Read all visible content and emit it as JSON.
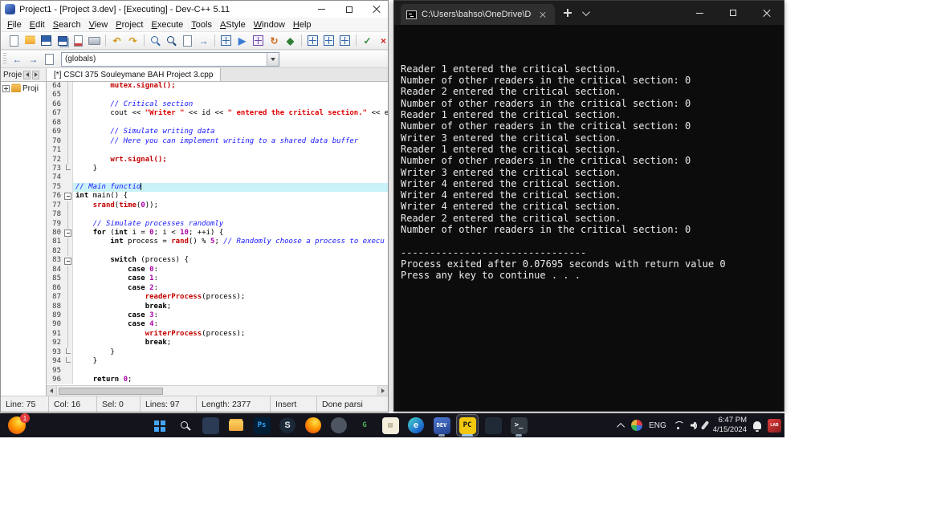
{
  "colors": {
    "keyword": "#000000",
    "comment": "#1616ff",
    "string": "#e00000",
    "number": "#aa00aa",
    "function": "#c40000",
    "line_highlight": "#c9f2f8",
    "console_bg": "#0c0c0c",
    "console_text": "#ececec",
    "taskbar_bg": "#14141d"
  },
  "devcpp": {
    "title": "Project1 - [Project 3.dev] - [Executing] - Dev-C++ 5.11",
    "menus": [
      "File",
      "Edit",
      "Search",
      "View",
      "Project",
      "Execute",
      "Tools",
      "AStyle",
      "Window",
      "Help"
    ],
    "toolbar_main": [
      {
        "name": "new-source-icon",
        "kind": "page"
      },
      {
        "name": "open-file-icon",
        "kind": "folder"
      },
      {
        "name": "save-icon",
        "kind": "save"
      },
      {
        "name": "save-all-icon",
        "kind": "saveall"
      },
      {
        "name": "close-file-icon",
        "kind": "pagex"
      },
      {
        "name": "print-icon",
        "kind": "print"
      },
      {
        "sep": true
      },
      {
        "name": "undo-icon",
        "glyph": "↶",
        "color": "#d29a22"
      },
      {
        "name": "redo-icon",
        "glyph": "↷",
        "color": "#d29a22"
      },
      {
        "sep": true
      },
      {
        "name": "find-icon",
        "kind": "find"
      },
      {
        "name": "find-in-files-icon",
        "kind": "find2"
      },
      {
        "name": "replace-icon",
        "kind": "page"
      },
      {
        "name": "goto-line-icon",
        "glyph": "→",
        "color": "#3465a4"
      },
      {
        "sep": true
      },
      {
        "name": "compile-icon",
        "kind": "grid"
      },
      {
        "name": "run-icon",
        "glyph": "▶",
        "color": "#3a7bd5"
      },
      {
        "name": "compile-run-icon",
        "kind": "gridrun"
      },
      {
        "name": "rebuild-icon",
        "glyph": "↻",
        "color": "#d2691e"
      },
      {
        "name": "debug-icon",
        "glyph": "◆",
        "color": "#2e7d32"
      },
      {
        "sep": true
      },
      {
        "name": "insert-icon",
        "kind": "grid"
      },
      {
        "name": "toggle-bookmark-icon",
        "kind": "grid"
      },
      {
        "name": "goto-bookmark-icon",
        "kind": "grid"
      },
      {
        "sep": true
      },
      {
        "name": "syntax-check-icon",
        "glyph": "✓",
        "color": "#2b8a3e"
      },
      {
        "name": "abort-compile-icon",
        "glyph": "×",
        "color": "#d02020"
      }
    ],
    "toolbar_nav": [
      {
        "name": "nav-back-icon",
        "glyph": "←",
        "color": "#3465a4"
      },
      {
        "name": "nav-forward-icon",
        "glyph": "→",
        "color": "#3465a4"
      },
      {
        "name": "goto-declaration-icon",
        "kind": "page"
      }
    ],
    "globals_combo": "(globals)",
    "project_tab": "Proje",
    "project_node": "Proji",
    "editor_tab": "[*] CSCI 375 Souleymane BAH Project 3.cpp",
    "editor": {
      "lines": [
        {
          "n": 64,
          "f": "vline",
          "s": [
            [
              "        ",
              "pl"
            ],
            [
              "mutex.signal();",
              "fn"
            ]
          ]
        },
        {
          "n": 65,
          "f": "vline",
          "s": []
        },
        {
          "n": 66,
          "f": "vline",
          "s": [
            [
              "        ",
              "pl"
            ],
            [
              "// Critical section",
              "com"
            ]
          ]
        },
        {
          "n": 67,
          "f": "vline",
          "s": [
            [
              "        cout << ",
              "pl"
            ],
            [
              "\"Writer \"",
              "str"
            ],
            [
              " << id << ",
              "pl"
            ],
            [
              "\" entered the critical section.\"",
              "str"
            ],
            [
              " << endl;",
              "pl"
            ]
          ]
        },
        {
          "n": 68,
          "f": "vline",
          "s": []
        },
        {
          "n": 69,
          "f": "vline",
          "s": [
            [
              "        ",
              "pl"
            ],
            [
              "// Simulate writing data",
              "com"
            ]
          ]
        },
        {
          "n": 70,
          "f": "vline",
          "s": [
            [
              "        ",
              "pl"
            ],
            [
              "// Here you can implement writing to a shared data buffer",
              "com"
            ]
          ]
        },
        {
          "n": 71,
          "f": "vline",
          "s": []
        },
        {
          "n": 72,
          "f": "vline",
          "s": [
            [
              "        ",
              "pl"
            ],
            [
              "wrt.signal();",
              "fn"
            ]
          ]
        },
        {
          "n": 73,
          "f": "end",
          "s": [
            [
              "    }",
              "pl"
            ]
          ]
        },
        {
          "n": 74,
          "f": "",
          "s": []
        },
        {
          "n": 75,
          "f": "",
          "hl": true,
          "caret": true,
          "s": [
            [
              "// Main functio",
              "com"
            ]
          ]
        },
        {
          "n": 76,
          "f": "box",
          "s": [
            [
              "int",
              "kw"
            ],
            [
              " main() {",
              "pl"
            ]
          ]
        },
        {
          "n": 77,
          "f": "vline",
          "s": [
            [
              "    ",
              "pl"
            ],
            [
              "srand",
              "fn"
            ],
            [
              "(",
              "pl"
            ],
            [
              "time",
              "fn"
            ],
            [
              "(",
              "pl"
            ],
            [
              "0",
              "num"
            ],
            [
              "));",
              "pl"
            ]
          ]
        },
        {
          "n": 78,
          "f": "vline",
          "s": []
        },
        {
          "n": 79,
          "f": "vline",
          "s": [
            [
              "    ",
              "pl"
            ],
            [
              "// Simulate processes randomly",
              "com"
            ]
          ]
        },
        {
          "n": 80,
          "f": "box",
          "s": [
            [
              "    ",
              "pl"
            ],
            [
              "for",
              "kw"
            ],
            [
              " (",
              "pl"
            ],
            [
              "int",
              "kw"
            ],
            [
              " i = ",
              "pl"
            ],
            [
              "0",
              "num"
            ],
            [
              "; i < ",
              "pl"
            ],
            [
              "10",
              "num"
            ],
            [
              "; ++i) {",
              "pl"
            ]
          ]
        },
        {
          "n": 81,
          "f": "vline",
          "s": [
            [
              "        ",
              "pl"
            ],
            [
              "int",
              "kw"
            ],
            [
              " process = ",
              "pl"
            ],
            [
              "rand",
              "fn"
            ],
            [
              "() % ",
              "pl"
            ],
            [
              "5",
              "num"
            ],
            [
              "; ",
              "pl"
            ],
            [
              "// Randomly choose a process to execu",
              "com"
            ]
          ]
        },
        {
          "n": 82,
          "f": "vline",
          "s": []
        },
        {
          "n": 83,
          "f": "box",
          "s": [
            [
              "        ",
              "pl"
            ],
            [
              "switch",
              "kw"
            ],
            [
              " (process) {",
              "pl"
            ]
          ]
        },
        {
          "n": 84,
          "f": "vline",
          "s": [
            [
              "            ",
              "pl"
            ],
            [
              "case",
              "kw"
            ],
            [
              " ",
              "pl"
            ],
            [
              "0",
              "num"
            ],
            [
              ":",
              "pl"
            ]
          ]
        },
        {
          "n": 85,
          "f": "vline",
          "s": [
            [
              "            ",
              "pl"
            ],
            [
              "case",
              "kw"
            ],
            [
              " ",
              "pl"
            ],
            [
              "1",
              "num"
            ],
            [
              ":",
              "pl"
            ]
          ]
        },
        {
          "n": 86,
          "f": "vline",
          "s": [
            [
              "            ",
              "pl"
            ],
            [
              "case",
              "kw"
            ],
            [
              " ",
              "pl"
            ],
            [
              "2",
              "num"
            ],
            [
              ":",
              "pl"
            ]
          ]
        },
        {
          "n": 87,
          "f": "vline",
          "s": [
            [
              "                ",
              "pl"
            ],
            [
              "readerProcess",
              "fn"
            ],
            [
              "(process);",
              "pl"
            ]
          ]
        },
        {
          "n": 88,
          "f": "vline",
          "s": [
            [
              "                ",
              "pl"
            ],
            [
              "break",
              "kw"
            ],
            [
              ";",
              "pl"
            ]
          ]
        },
        {
          "n": 89,
          "f": "vline",
          "s": [
            [
              "            ",
              "pl"
            ],
            [
              "case",
              "kw"
            ],
            [
              " ",
              "pl"
            ],
            [
              "3",
              "num"
            ],
            [
              ":",
              "pl"
            ]
          ]
        },
        {
          "n": 90,
          "f": "vline",
          "s": [
            [
              "            ",
              "pl"
            ],
            [
              "case",
              "kw"
            ],
            [
              " ",
              "pl"
            ],
            [
              "4",
              "num"
            ],
            [
              ":",
              "pl"
            ]
          ]
        },
        {
          "n": 91,
          "f": "vline",
          "s": [
            [
              "                ",
              "pl"
            ],
            [
              "writerProcess",
              "fn"
            ],
            [
              "(process);",
              "pl"
            ]
          ]
        },
        {
          "n": 92,
          "f": "vline",
          "s": [
            [
              "                ",
              "pl"
            ],
            [
              "break",
              "kw"
            ],
            [
              ";",
              "pl"
            ]
          ]
        },
        {
          "n": 93,
          "f": "end",
          "s": [
            [
              "        }",
              "pl"
            ]
          ]
        },
        {
          "n": 94,
          "f": "end",
          "s": [
            [
              "    }",
              "pl"
            ]
          ]
        },
        {
          "n": 95,
          "f": "",
          "s": []
        },
        {
          "n": 96,
          "f": "",
          "s": [
            [
              "    ",
              "pl"
            ],
            [
              "return",
              "kw"
            ],
            [
              " ",
              "pl"
            ],
            [
              "0",
              "num"
            ],
            [
              ";",
              "pl"
            ]
          ]
        }
      ]
    },
    "status": {
      "line": "Line: 75",
      "col": "Col: 16",
      "sel": "Sel: 0",
      "total_lines": "Lines: 97",
      "length": "Length: 2377",
      "mode": "Insert",
      "parse_status": "Done parsi"
    }
  },
  "console": {
    "tab_title": "C:\\Users\\bahso\\OneDrive\\Do",
    "lines": [
      "Reader 1 entered the critical section.",
      "Number of other readers in the critical section: 0",
      "Reader 2 entered the critical section.",
      "Number of other readers in the critical section: 0",
      "Reader 1 entered the critical section.",
      "Number of other readers in the critical section: 0",
      "Writer 3 entered the critical section.",
      "Reader 1 entered the critical section.",
      "Number of other readers in the critical section: 0",
      "Writer 3 entered the critical section.",
      "Writer 4 entered the critical section.",
      "Writer 4 entered the critical section.",
      "Writer 4 entered the critical section.",
      "Reader 2 entered the critical section.",
      "Number of other readers in the critical section: 0",
      "",
      "--------------------------------",
      "Process exited after 0.07695 seconds with return value 0",
      "Press any key to continue . . ."
    ]
  },
  "taskbar": {
    "widgets_badge": "1",
    "language": "ENG",
    "time": "6:47 PM",
    "date": "4/15/2024",
    "corner_label": "LAB",
    "apps": [
      {
        "name": "start-button",
        "kind": "start"
      },
      {
        "name": "search-button",
        "kind": "search"
      },
      {
        "name": "app-icon-1",
        "kind": "tile",
        "bg": "#2b3a55"
      },
      {
        "name": "file-explorer-icon",
        "kind": "folder"
      },
      {
        "name": "photoshop-icon",
        "kind": "tile",
        "text": "Ps",
        "bg": "#001e36",
        "fg": "#31a8ff"
      },
      {
        "name": "steam-icon",
        "kind": "circle",
        "text": "S",
        "bg": "#1b2838",
        "fg": "#dfe8f0"
      },
      {
        "name": "firefox-icon",
        "kind": "circle",
        "bg": "radial-gradient(circle at 62% 30%, #ffe14a 0%, #ff9800 45%, #e4590d 80%)"
      },
      {
        "name": "app-icon-2",
        "kind": "circle",
        "bg": "#4d5560"
      },
      {
        "name": "g-app-icon",
        "kind": "tile",
        "text": "G",
        "fg": "#4db053",
        "bg": "transparent"
      },
      {
        "name": "notebook-icon",
        "kind": "tile",
        "text": "▤",
        "fg": "#9a8d72",
        "bg": "#f4eedd"
      },
      {
        "name": "edge-icon",
        "kind": "circle",
        "text": "e",
        "fg": "#ffffff",
        "bg": "linear-gradient(135deg,#45d6c8 0%,#1f6fd0 70%,#124a9a 100%)"
      },
      {
        "name": "devcpp-icon",
        "kind": "tile",
        "text": "DEV",
        "fg": "#ffffff",
        "bg": "linear-gradient(160deg,#4d78d0,#23418f)",
        "active": true
      },
      {
        "name": "console-app-icon",
        "kind": "tile",
        "text": "PC",
        "fg": "#111111",
        "bg": "#f2c80f",
        "active": true,
        "focused": true
      },
      {
        "name": "app-icon-3",
        "kind": "tile",
        "bg": "#1f2a36"
      },
      {
        "name": "terminal-icon",
        "kind": "tile",
        "text": ">_",
        "fg": "#ffffff",
        "bg": "#333a42",
        "active": true
      }
    ]
  }
}
